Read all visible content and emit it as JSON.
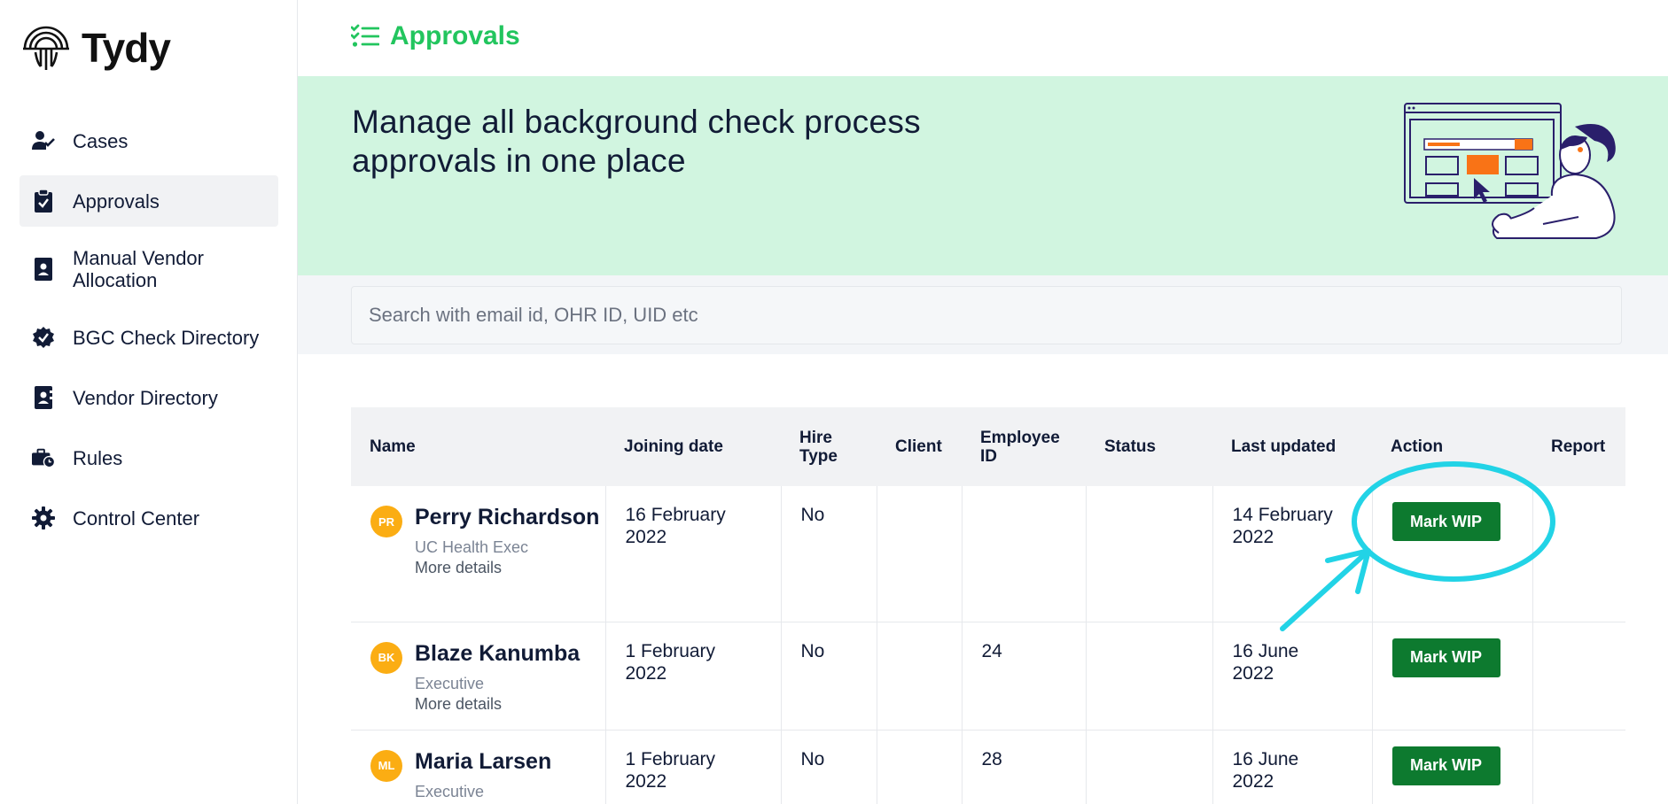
{
  "app": {
    "name": "Tydy"
  },
  "sidebar": {
    "items": [
      {
        "label": "Cases",
        "icon": "user-check-icon"
      },
      {
        "label": "Approvals",
        "icon": "clipboard-check-icon",
        "active": true
      },
      {
        "label": "Manual Vendor Allocation",
        "icon": "contact-book-icon"
      },
      {
        "label": "BGC Check Directory",
        "icon": "badge-check-icon"
      },
      {
        "label": "Vendor Directory",
        "icon": "vendor-book-icon"
      },
      {
        "label": "Rules",
        "icon": "briefcase-clock-icon"
      },
      {
        "label": "Control Center",
        "icon": "gear-icon"
      }
    ]
  },
  "header": {
    "title": "Approvals",
    "icon": "checklist-icon"
  },
  "banner": {
    "text": "Manage all background check process approvals in one place"
  },
  "search": {
    "placeholder": "Search with email id, OHR ID, UID etc"
  },
  "table": {
    "columns": [
      "Name",
      "Joining date",
      "Hire Type",
      "Client",
      "Employee ID",
      "Status",
      "Last updated",
      "Action",
      "Report"
    ],
    "rows": [
      {
        "initials": "PR",
        "name": "Perry Richardson",
        "role": "UC Health Exec",
        "more": "More details",
        "joining_date": "16 February 2022",
        "hire_type": "No",
        "client": "",
        "employee_id": "",
        "status": "",
        "last_updated": "14 February 2022",
        "action": "Mark WIP",
        "report": ""
      },
      {
        "initials": "BK",
        "name": "Blaze Kanumba",
        "role": "Executive",
        "more": "More details",
        "joining_date": "1 February 2022",
        "hire_type": "No",
        "client": "",
        "employee_id": "24",
        "status": "",
        "last_updated": "16 June 2022",
        "action": "Mark WIP",
        "report": ""
      },
      {
        "initials": "ML",
        "name": "Maria Larsen",
        "role": "Executive",
        "more": "",
        "joining_date": "1 February 2022",
        "hire_type": "No",
        "client": "",
        "employee_id": "28",
        "status": "",
        "last_updated": "16 June 2022",
        "action": "Mark WIP",
        "report": ""
      }
    ]
  },
  "colors": {
    "brand_green": "#22c55e",
    "banner_bg": "#d1f5e0",
    "button_green": "#0d7a2f",
    "avatar": "#fbad13",
    "annotation": "#22d3e6"
  }
}
